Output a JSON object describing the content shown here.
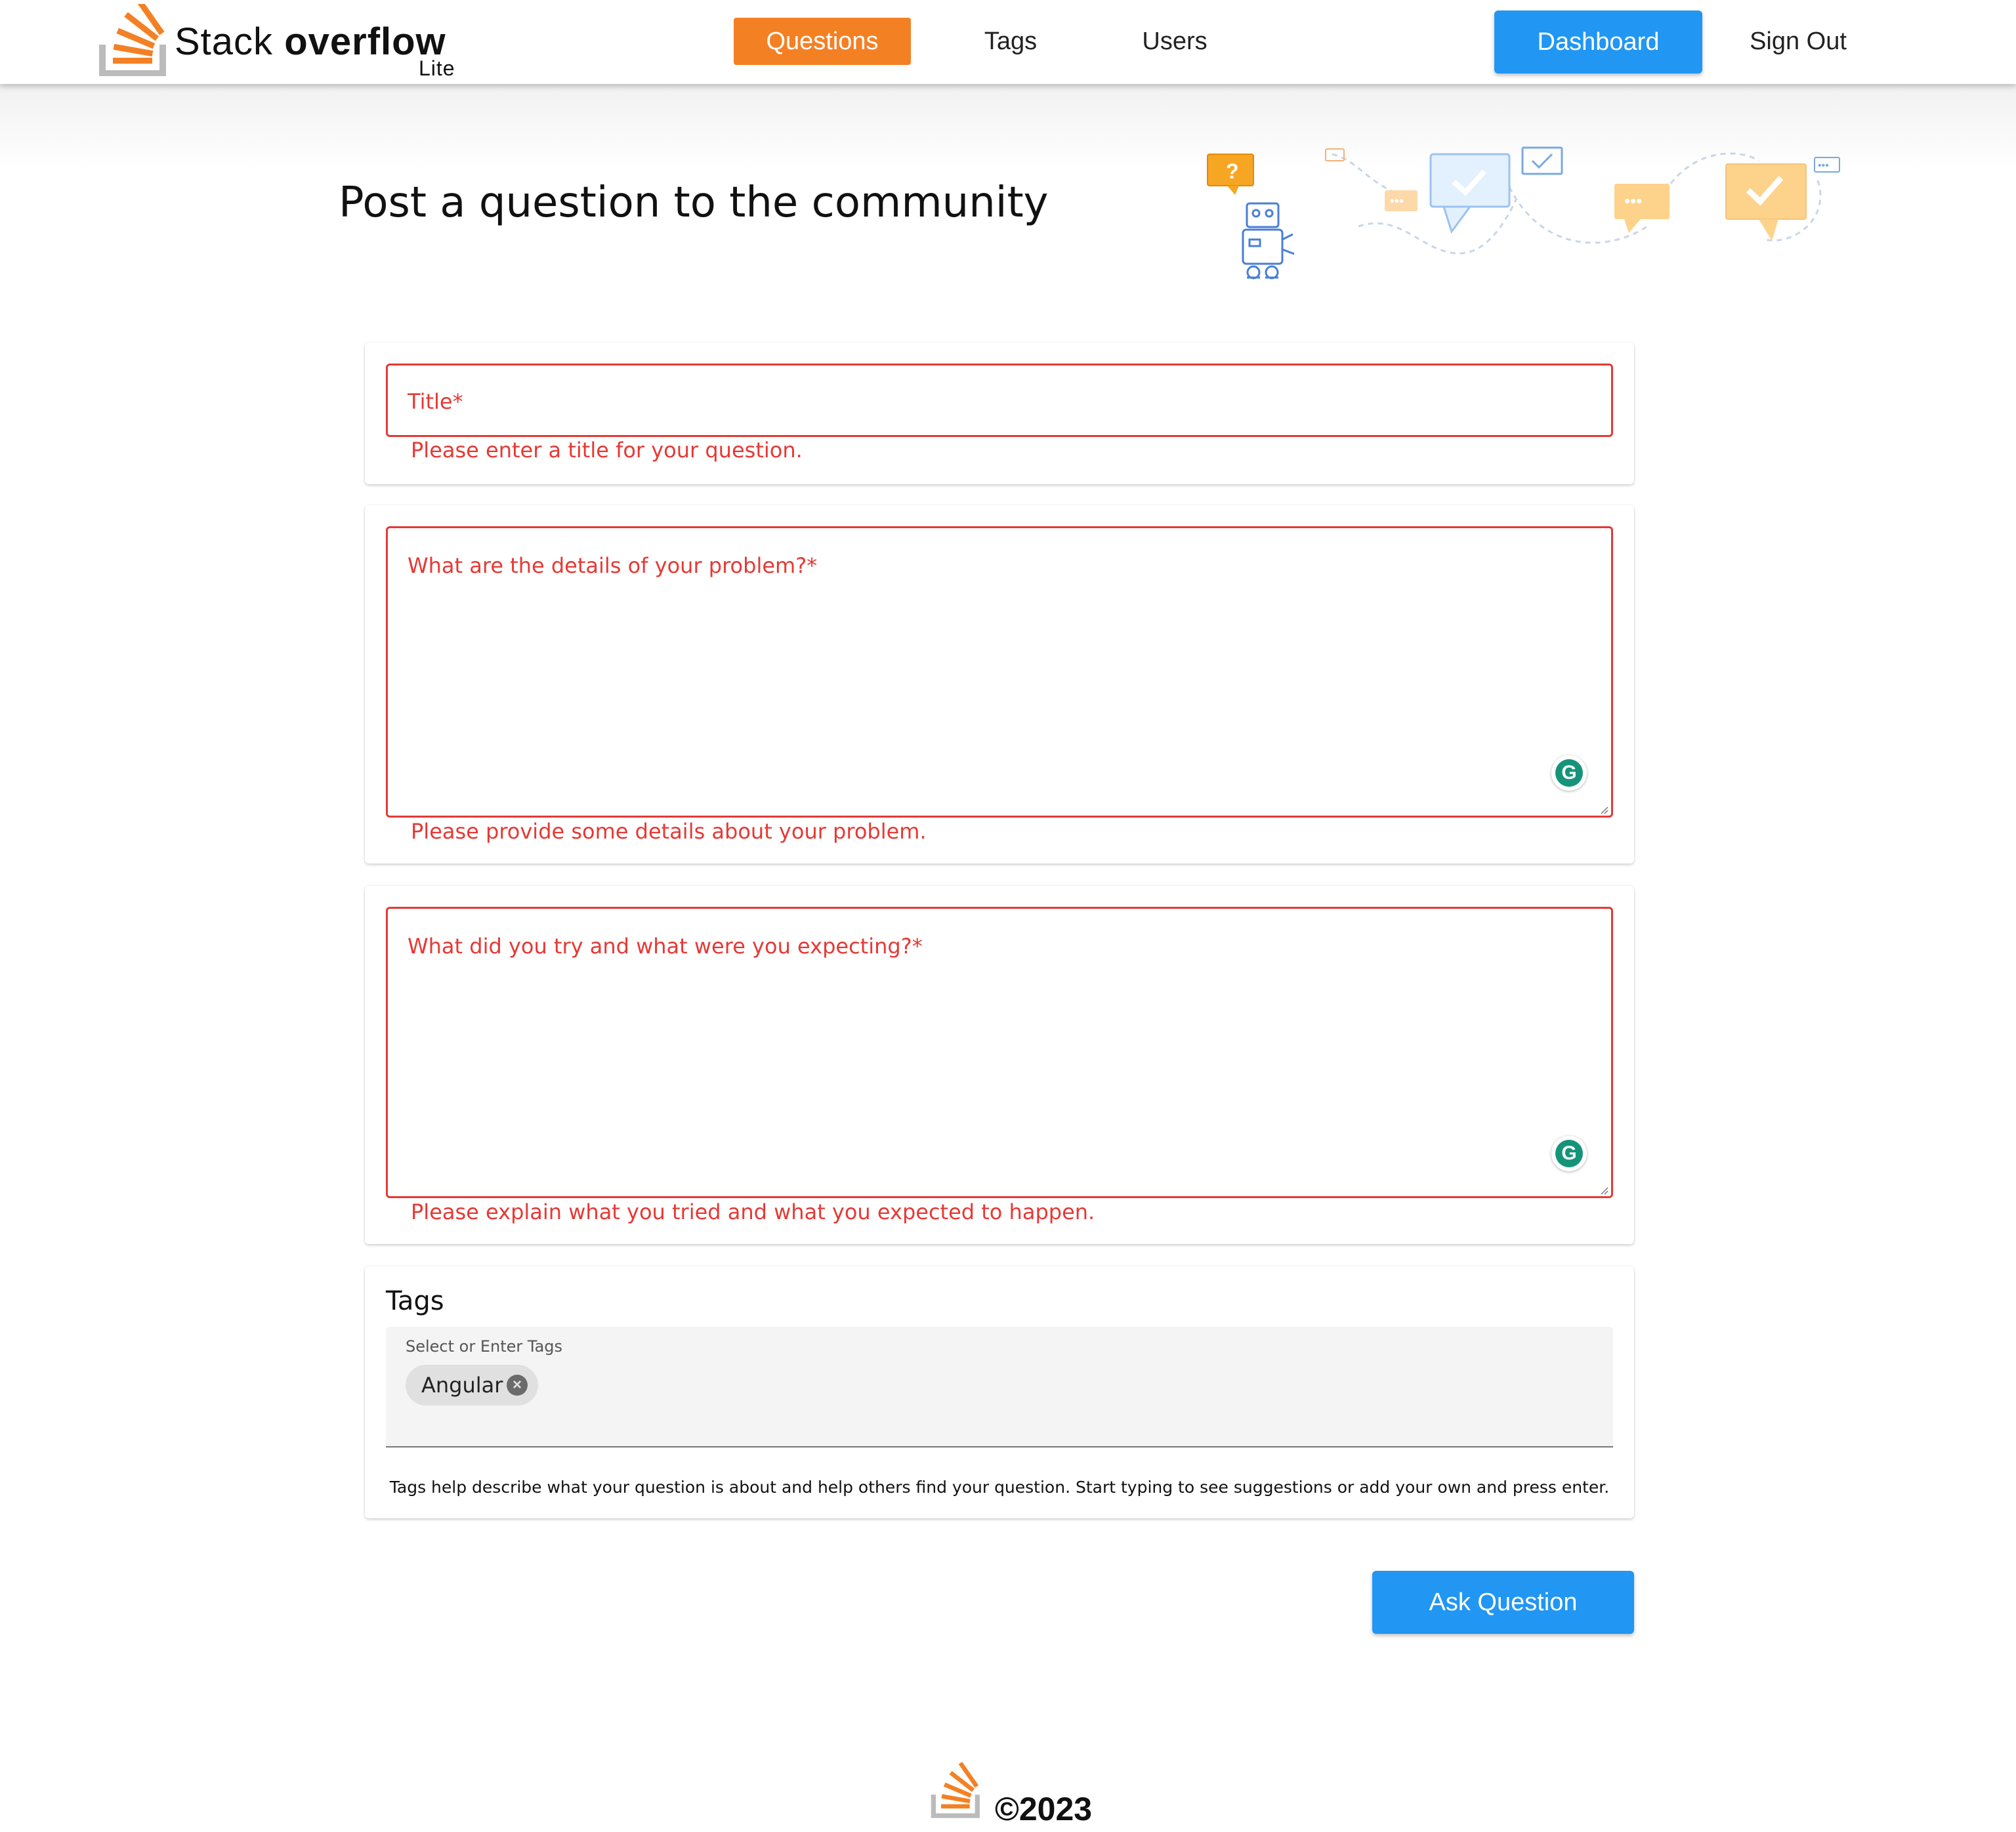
{
  "brand": {
    "name_regular": "Stack",
    "name_bold": "overflow",
    "subtitle": "Lite"
  },
  "nav": {
    "questions": "Questions",
    "tags": "Tags",
    "users": "Users",
    "dashboard": "Dashboard",
    "sign_out": "Sign Out"
  },
  "page": {
    "title": "Post a question to the community"
  },
  "form": {
    "title_field": {
      "label": "Title*",
      "error": "Please enter a title for your question."
    },
    "details_field": {
      "label": "What are the details of your problem?*",
      "error": "Please provide some details about your problem."
    },
    "tried_field": {
      "label": "What did you try and what were you expecting?*",
      "error": "Please explain what you tried and what you expected to happen."
    },
    "tags": {
      "heading": "Tags",
      "input_label": "Select or Enter Tags",
      "chips": [
        {
          "label": "Angular"
        }
      ],
      "help": "Tags help describe what your question is about and help others find your question. Start typing to see suggestions or add your own and press enter."
    },
    "submit": "Ask Question"
  },
  "footer": {
    "copyright": "©2023"
  },
  "colors": {
    "accent_orange": "#f48024",
    "primary_blue": "#2196f3",
    "error_red": "#e53935"
  }
}
